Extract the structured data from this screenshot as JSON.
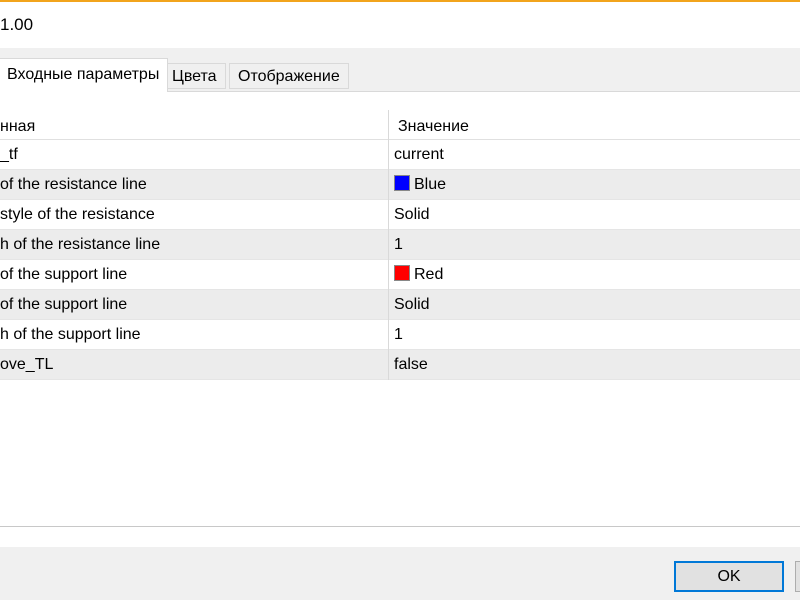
{
  "window": {
    "title": "1.00"
  },
  "tabs": [
    {
      "label": "Входные параметры",
      "active": true
    },
    {
      "label": "Цвета",
      "active": false
    },
    {
      "label": "Отображение",
      "active": false
    }
  ],
  "table": {
    "columns": [
      "нная",
      "Значение"
    ],
    "rows": [
      {
        "name": "_tf",
        "value": "current"
      },
      {
        "name": " of the resistance line",
        "value": "Blue",
        "swatch_color": "#0000ff"
      },
      {
        "name": "style of the resistance",
        "value": "Solid"
      },
      {
        "name": "h of the resistance line",
        "value": "1"
      },
      {
        "name": " of the support line",
        "value": "Red",
        "swatch_color": "#ff0000"
      },
      {
        "name": " of the support line",
        "value": "Solid"
      },
      {
        "name": "h of the support line",
        "value": "1"
      },
      {
        "name": "ove_TL",
        "value": "false"
      }
    ]
  },
  "buttons": {
    "ok_label": "OK"
  },
  "colors": {
    "accent": "#f2a41c",
    "focus_border": "#0078d7"
  }
}
